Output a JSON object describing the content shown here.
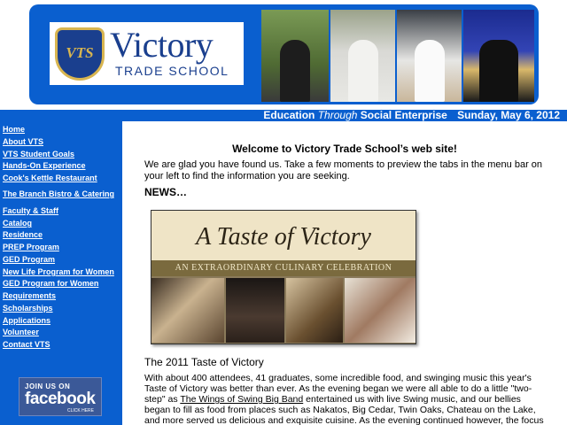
{
  "header": {
    "logo_initials": "VTS",
    "logo_word": "Victory",
    "logo_sub": "TRADE SCHOOL",
    "photos": [
      "graduate-with-book-photo",
      "chef-photo",
      "chef-cooking-photo",
      "graduate-cap-gown-photo"
    ]
  },
  "datebar": {
    "tagline_pre": "Education",
    "tagline_em": "Through",
    "tagline_post": "Social Enterprise",
    "date": "Sunday, May 6, 2012"
  },
  "sidebar": {
    "items": [
      {
        "label": "Home"
      },
      {
        "label": "About VTS"
      },
      {
        "label": "VTS Student Goals"
      },
      {
        "label": "Hands-On Experience"
      },
      {
        "label": "Cook's Kettle Restaurant"
      },
      {
        "label": "The Branch Bistro & Catering"
      },
      {
        "label": "Faculty & Staff"
      },
      {
        "label": "Catalog"
      },
      {
        "label": "Residence"
      },
      {
        "label": "PREP Program"
      },
      {
        "label": "GED Program"
      },
      {
        "label": "New Life Program for Women"
      },
      {
        "label": "GED Program for Women"
      },
      {
        "label": "Requirements"
      },
      {
        "label": "Scholarships"
      },
      {
        "label": "Applications"
      },
      {
        "label": "Volunteer"
      },
      {
        "label": "Contact VTS"
      }
    ],
    "facebook": {
      "line1": "JOIN US ON",
      "brand": "facebook",
      "line3": "CLICK HERE"
    }
  },
  "main": {
    "welcome": "Welcome to Victory Trade School’s web site!",
    "intro": "We are glad you have found us.  Take a few moments to preview the tabs in the menu bar on your left to find the information you are seeking.",
    "news_heading": "NEWS…",
    "poster": {
      "title": "A Taste of Victory",
      "band": "AN EXTRAORDINARY CULINARY CELEBRATION"
    },
    "story_title": "The 2011 Taste of Victory",
    "story_part1": "With about 400 attendees, 41 graduates, some incredible food, and swinging music this year's Taste of Victory was better than ever. As the evening began we were all able to do a little \"two-step\" as ",
    "story_link": "The Wings of Swing Big Band",
    "story_part2": " entertained us with live Swing music, and our bellies began to fill as food from places such as Nakatos, Big Cedar, Twin Oaks, Chateau on the Lake, and more served us delicious and exquisite cuisine. As the evening continued however, the focus moved towards the"
  },
  "colors": {
    "brand_blue": "#0a5fcf",
    "logo_navy": "#1a3f8e",
    "logo_gold": "#d8b550"
  }
}
